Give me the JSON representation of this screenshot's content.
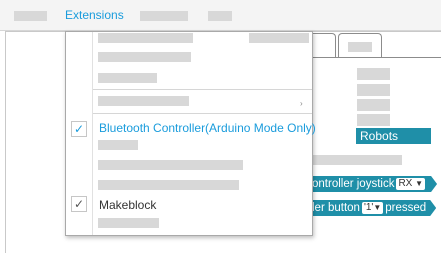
{
  "menubar": {
    "items": [
      "Extensions"
    ]
  },
  "dropdown": {
    "items": [
      {
        "label": "Bluetooth Controller(Arduino Mode Only)",
        "checked": true,
        "color": "#1a9cdc"
      },
      {
        "label": "Makeblock",
        "checked": true,
        "color": "#333333"
      }
    ],
    "check_glyph": "✓",
    "submenu_arrow": "›"
  },
  "palette": {
    "category": "Robots"
  },
  "blocks": {
    "joystick": {
      "text": "ontroller joystick",
      "option": "RX",
      "caret": "▼"
    },
    "button": {
      "text": "ler button",
      "option": "'1'",
      "caret": "▼",
      "suffix": "pressed"
    }
  },
  "colors": {
    "accent": "#1a9cdc",
    "block": "#1f8fa8",
    "redacted": "#d8d8d8"
  }
}
